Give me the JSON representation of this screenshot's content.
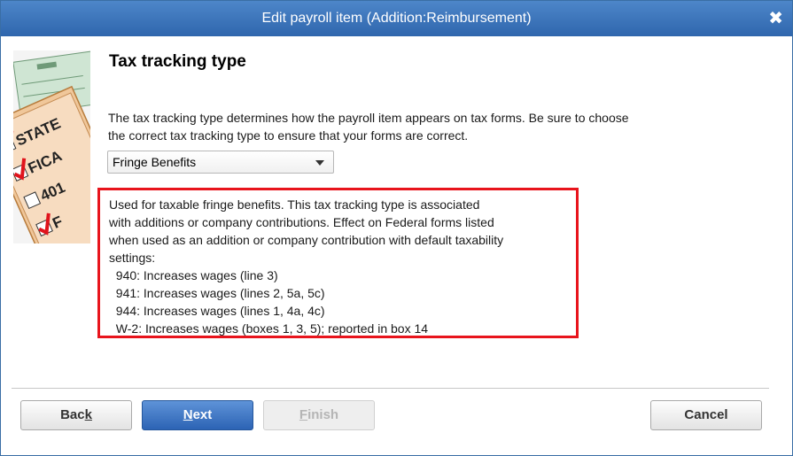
{
  "window": {
    "title": "Edit payroll item (Addition:Reimbursement)",
    "close_glyph": "✖"
  },
  "illustration": {
    "labels": [
      "STATE",
      "FICA",
      "401",
      "F"
    ]
  },
  "heading": "Tax tracking type",
  "description": {
    "line1": "The tax tracking type determines how the payroll item appears on tax forms.  Be sure to choose",
    "line2": "the correct tax tracking type to ensure that your forms are correct."
  },
  "tax_type_select": {
    "value": "Fringe Benefits"
  },
  "info_box": {
    "lines": [
      "Used for taxable fringe benefits.  This tax tracking type is associated",
      "with additions or company contributions.  Effect on Federal forms listed",
      "when used as an addition or company contribution with default taxability",
      "settings:",
      "  940: Increases wages (line 3)",
      "  941: Increases wages (lines 2, 5a, 5c)",
      "  944: Increases wages (lines 1, 4a, 4c)",
      "  W-2: Increases wages (boxes 1, 3, 5); reported in box 14"
    ]
  },
  "buttons": {
    "back": {
      "pre": "Bac",
      "accel": "k",
      "post": ""
    },
    "next": {
      "pre": "",
      "accel": "N",
      "post": "ext"
    },
    "finish": {
      "pre": "",
      "accel": "F",
      "post": "inish"
    },
    "cancel": "Cancel"
  },
  "colors": {
    "titlebar": "#2f66ad",
    "highlight_border": "#e8141c",
    "primary_button": "#2c63b4"
  }
}
